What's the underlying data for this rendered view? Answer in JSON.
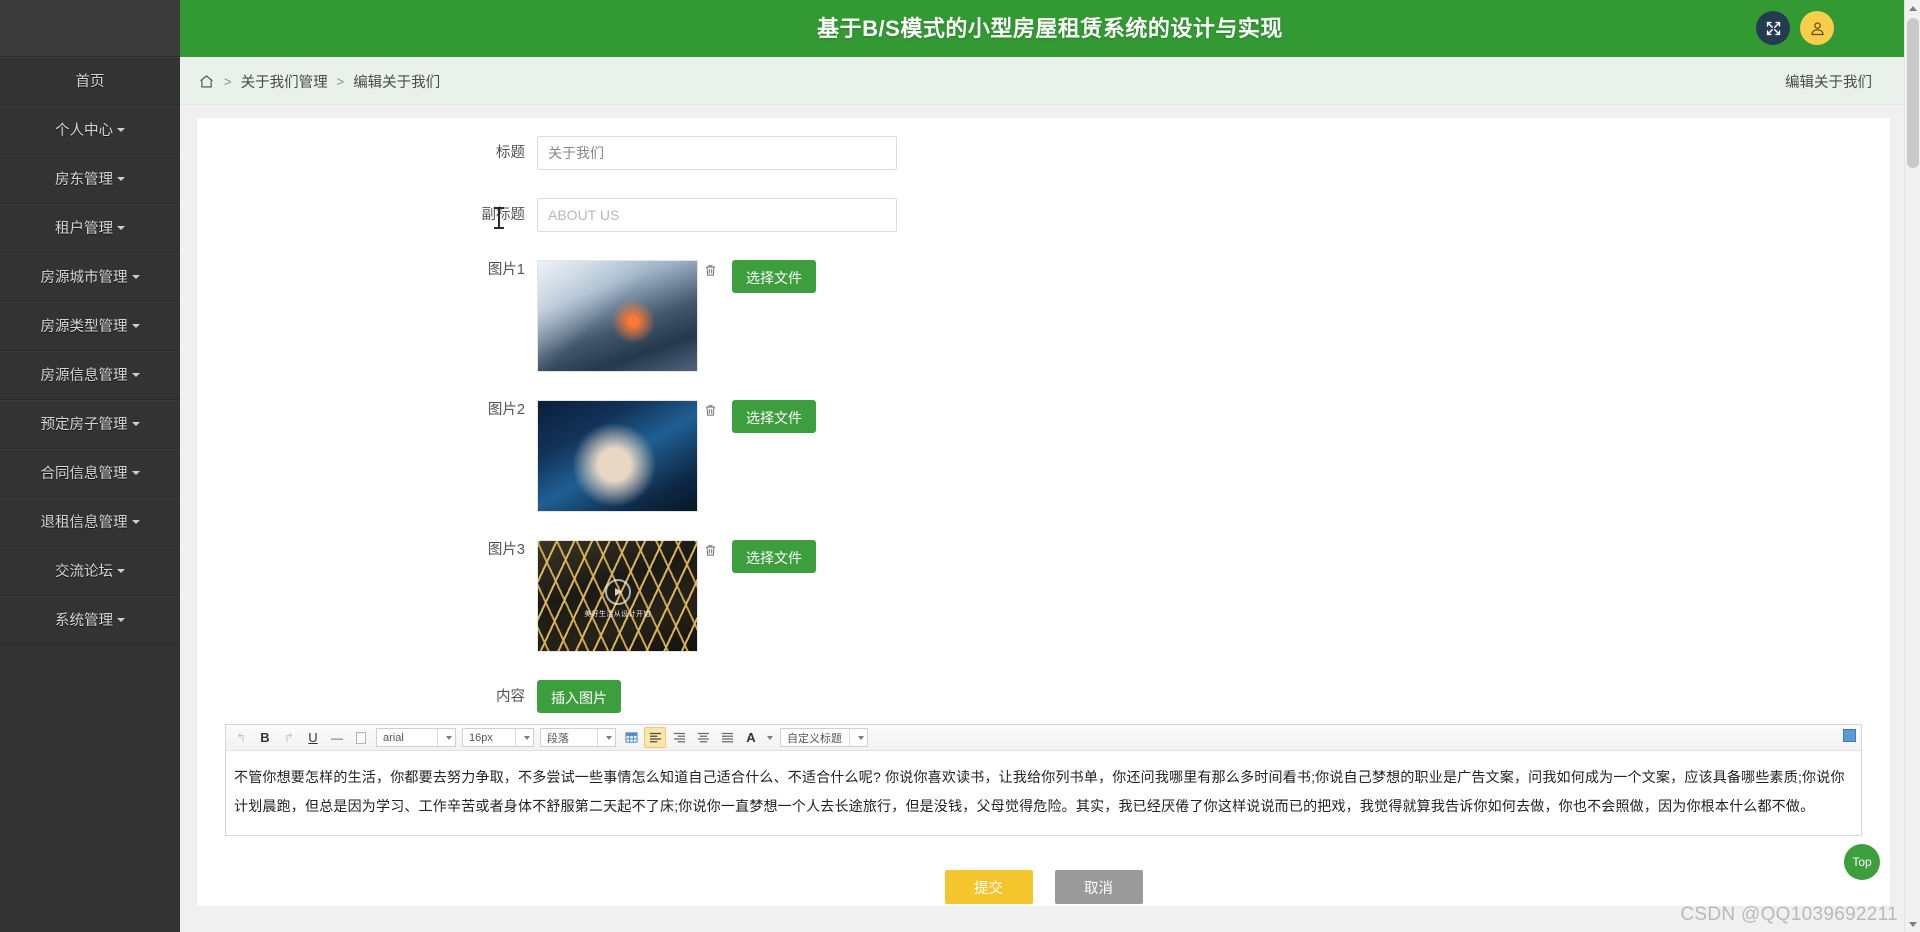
{
  "header": {
    "title": "基于B/S模式的小型房屋租赁系统的设计与实现",
    "fullscreen_icon": "fullscreen-icon",
    "user_icon": "user-avatar-icon",
    "accent_green": "#339933",
    "icon_dark": "#243b52",
    "icon_yellow": "#f7cd4a"
  },
  "sidebar": {
    "items": [
      {
        "label": "首页",
        "caret": false
      },
      {
        "label": "个人中心",
        "caret": true
      },
      {
        "label": "房东管理",
        "caret": true
      },
      {
        "label": "租户管理",
        "caret": true
      },
      {
        "label": "房源城市管理",
        "caret": true
      },
      {
        "label": "房源类型管理",
        "caret": true
      },
      {
        "label": "房源信息管理",
        "caret": true
      },
      {
        "label": "预定房子管理",
        "caret": true
      },
      {
        "label": "合同信息管理",
        "caret": true
      },
      {
        "label": "退租信息管理",
        "caret": true
      },
      {
        "label": "交流论坛",
        "caret": true
      },
      {
        "label": "系统管理",
        "caret": true
      }
    ]
  },
  "breadcrumb": {
    "home_icon": "home-icon",
    "sep": ">",
    "items": [
      "关于我们管理",
      "编辑关于我们"
    ],
    "right_label": "编辑关于我们"
  },
  "form": {
    "title_label": "标题",
    "title_value": "关于我们",
    "subtitle_label": "副标题",
    "subtitle_value": "",
    "subtitle_placeholder": "ABOUT US",
    "image_rows": [
      {
        "label": "图片1",
        "file_button": "选择文件",
        "delete_icon": "trash-icon"
      },
      {
        "label": "图片2",
        "file_button": "选择文件",
        "delete_icon": "trash-icon"
      },
      {
        "label": "图片3",
        "file_button": "选择文件",
        "delete_icon": "trash-icon",
        "caption": "美好生活从设计开始"
      }
    ],
    "content_label": "内容",
    "insert_image_button": "插入图片",
    "submit_button": "提交",
    "cancel_button": "取消"
  },
  "editor": {
    "toolbar": {
      "undo": "↰",
      "bold": "B",
      "redo": "↱",
      "underline": "U",
      "hr": "—",
      "page_break": "▭",
      "font_family": "arial",
      "font_size": "16px",
      "paragraph": "段落",
      "table_icon": "table-icon",
      "align_left": "align-left-icon",
      "align_center": "align-center-icon",
      "align_right": "align-right-icon",
      "align_justify": "align-justify-icon",
      "text_color": "A",
      "custom_style": "自定义标题",
      "maximize": "maximize-icon"
    },
    "content": "不管你想要怎样的生活，你都要去努力争取，不多尝试一些事情怎么知道自己适合什么、不适合什么呢? 你说你喜欢读书，让我给你列书单，你还问我哪里有那么多时间看书;你说自己梦想的职业是广告文案，问我如何成为一个文案，应该具备哪些素质;你说你计划晨跑，但总是因为学习、工作辛苦或者身体不舒服第二天起不了床;你说你一直梦想一个人去长途旅行，但是没钱，父母觉得危险。其实，我已经厌倦了你这样说说而已的把戏，我觉得就算我告诉你如何去做，你也不会照做，因为你根本什么都不做。"
  },
  "misc": {
    "top_button": "Top",
    "watermark": "CSDN @QQ1039692211"
  }
}
